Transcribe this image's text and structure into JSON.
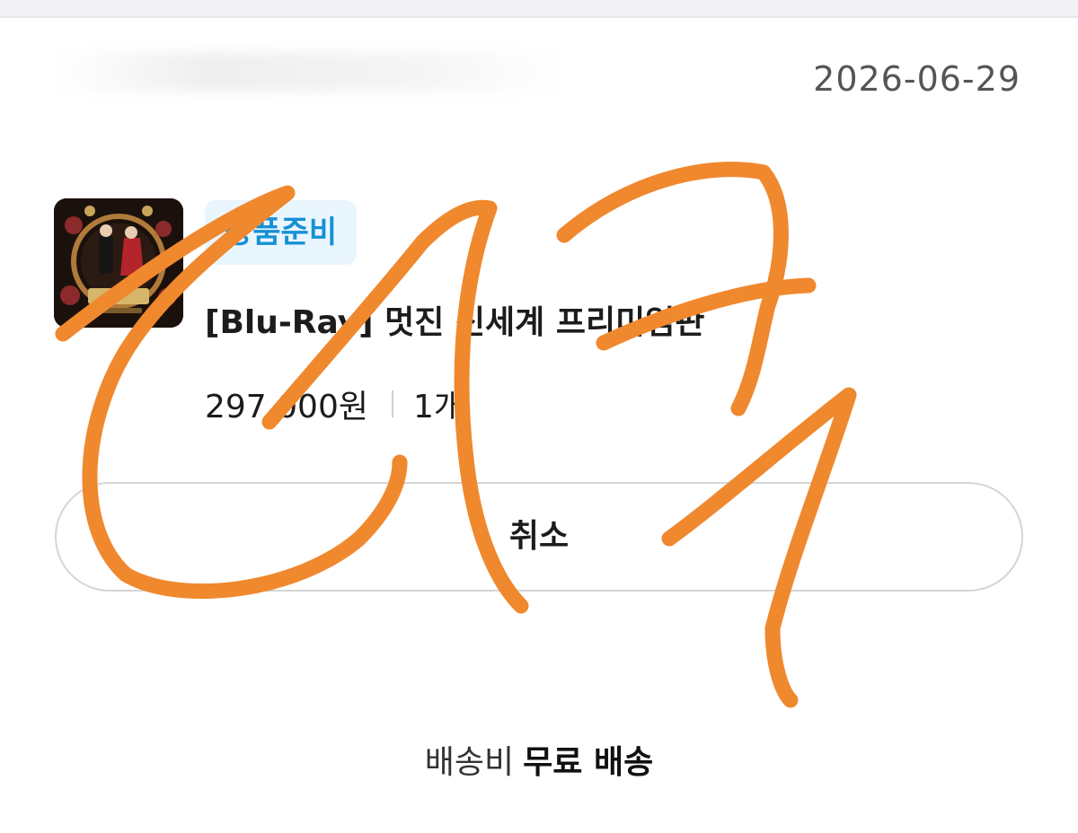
{
  "order": {
    "date": "2026-06-29"
  },
  "item": {
    "status": "상품준비",
    "title": "[Blu-Ray] 멋진 신세계 프리미엄판",
    "price": "297,000원",
    "quantity": "1개",
    "thumbnail_icon": "product-thumbnail-icon"
  },
  "actions": {
    "cancel_label": "취소"
  },
  "shipping": {
    "label": "배송비",
    "value": "무료 배송"
  },
  "colors": {
    "accent": "#1591d6",
    "badge_bg": "#eaf6fd",
    "scribble": "#f0882e"
  }
}
